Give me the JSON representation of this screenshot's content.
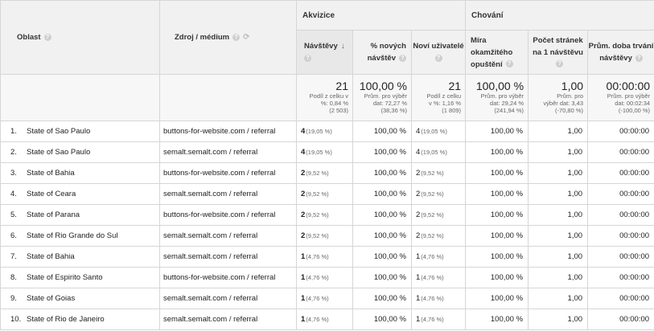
{
  "groups": {
    "akvizice": "Akvizice",
    "chovani": "Chování"
  },
  "columns": {
    "oblast": "Oblast",
    "zdroj": "Zdroj / médium",
    "navstevy": "Návštěvy",
    "nove_navstevy": "% nových návštěv",
    "novi_uzivatele": "Noví uživatelé",
    "mira": "Míra okamžitého opuštění",
    "pocet_stranek": "Počet stránek na 1 návštěvu",
    "doba": "Prům. doba trvání návštěvy"
  },
  "totals": {
    "navstevy": {
      "value": "21",
      "l1": "Podíl z celku v",
      "l2": "%: 0,84 %",
      "l3": "(2 503)"
    },
    "nove_navstevy": {
      "value": "100,00 %",
      "l1": "Prům. pro výběr",
      "l2": "dat: 72,27 %",
      "l3": "(38,36 %)"
    },
    "novi_uzivatele": {
      "value": "21",
      "l1": "Podíl z celku",
      "l2": "v %: 1,16 %",
      "l3": "(1 809)"
    },
    "mira": {
      "value": "100,00 %",
      "l1": "Prům. pro výběr",
      "l2": "dat: 29,24 %",
      "l3": "(241,94 %)"
    },
    "pocet_stranek": {
      "value": "1,00",
      "l1": "Prům. pro",
      "l2": "výběr dat: 3,43",
      "l3": "(-70,80 %)"
    },
    "doba": {
      "value": "00:00:00",
      "l1": "Prům. pro výběr",
      "l2": "dat: 00:02:34",
      "l3": "(-100,00 %)"
    }
  },
  "rows": [
    {
      "idx": "1.",
      "oblast": "State of Sao Paulo",
      "zdroj": "buttons-for-website.com / referral",
      "nav": "4",
      "nav_pct": "(19,05 %)",
      "nove": "100,00 %",
      "novi": "4",
      "novi_pct": "(19,05 %)",
      "mira": "100,00 %",
      "pocet": "1,00",
      "doba": "00:00:00"
    },
    {
      "idx": "2.",
      "oblast": "State of Sao Paulo",
      "zdroj": "semalt.semalt.com / referral",
      "nav": "4",
      "nav_pct": "(19,05 %)",
      "nove": "100,00 %",
      "novi": "4",
      "novi_pct": "(19,05 %)",
      "mira": "100,00 %",
      "pocet": "1,00",
      "doba": "00:00:00"
    },
    {
      "idx": "3.",
      "oblast": "State of Bahia",
      "zdroj": "buttons-for-website.com / referral",
      "nav": "2",
      "nav_pct": "(9,52 %)",
      "nove": "100,00 %",
      "novi": "2",
      "novi_pct": "(9,52 %)",
      "mira": "100,00 %",
      "pocet": "1,00",
      "doba": "00:00:00"
    },
    {
      "idx": "4.",
      "oblast": "State of Ceara",
      "zdroj": "semalt.semalt.com / referral",
      "nav": "2",
      "nav_pct": "(9,52 %)",
      "nove": "100,00 %",
      "novi": "2",
      "novi_pct": "(9,52 %)",
      "mira": "100,00 %",
      "pocet": "1,00",
      "doba": "00:00:00"
    },
    {
      "idx": "5.",
      "oblast": "State of Parana",
      "zdroj": "buttons-for-website.com / referral",
      "nav": "2",
      "nav_pct": "(9,52 %)",
      "nove": "100,00 %",
      "novi": "2",
      "novi_pct": "(9,52 %)",
      "mira": "100,00 %",
      "pocet": "1,00",
      "doba": "00:00:00"
    },
    {
      "idx": "6.",
      "oblast": "State of Rio Grande do Sul",
      "zdroj": "semalt.semalt.com / referral",
      "nav": "2",
      "nav_pct": "(9,52 %)",
      "nove": "100,00 %",
      "novi": "2",
      "novi_pct": "(9,52 %)",
      "mira": "100,00 %",
      "pocet": "1,00",
      "doba": "00:00:00"
    },
    {
      "idx": "7.",
      "oblast": "State of Bahia",
      "zdroj": "semalt.semalt.com / referral",
      "nav": "1",
      "nav_pct": "(4,76 %)",
      "nove": "100,00 %",
      "novi": "1",
      "novi_pct": "(4,76 %)",
      "mira": "100,00 %",
      "pocet": "1,00",
      "doba": "00:00:00"
    },
    {
      "idx": "8.",
      "oblast": "State of Espirito Santo",
      "zdroj": "buttons-for-website.com / referral",
      "nav": "1",
      "nav_pct": "(4,76 %)",
      "nove": "100,00 %",
      "novi": "1",
      "novi_pct": "(4,76 %)",
      "mira": "100,00 %",
      "pocet": "1,00",
      "doba": "00:00:00"
    },
    {
      "idx": "9.",
      "oblast": "State of Goias",
      "zdroj": "semalt.semalt.com / referral",
      "nav": "1",
      "nav_pct": "(4,76 %)",
      "nove": "100,00 %",
      "novi": "1",
      "novi_pct": "(4,76 %)",
      "mira": "100,00 %",
      "pocet": "1,00",
      "doba": "00:00:00"
    },
    {
      "idx": "10.",
      "oblast": "State of Rio de Janeiro",
      "zdroj": "semalt.semalt.com / referral",
      "nav": "1",
      "nav_pct": "(4,76 %)",
      "nove": "100,00 %",
      "novi": "1",
      "novi_pct": "(4,76 %)",
      "mira": "100,00 %",
      "pocet": "1,00",
      "doba": "00:00:00"
    }
  ]
}
